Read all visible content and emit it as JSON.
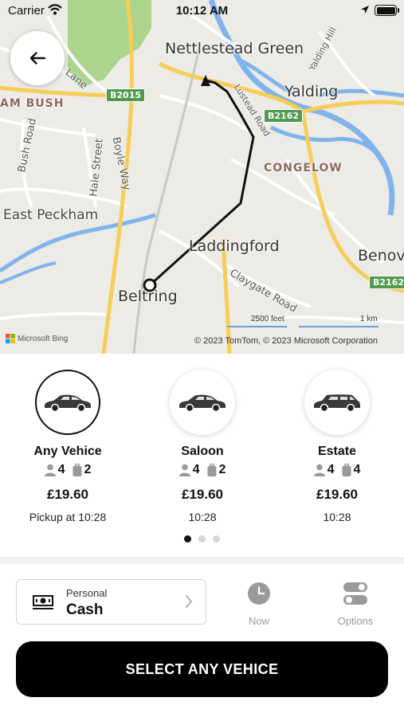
{
  "status_bar": {
    "carrier": "Carrier",
    "time": "10:12 AM"
  },
  "map": {
    "places": {
      "nettlestead_green": "Nettlestead Green",
      "yalding": "Yalding",
      "am_bush": "AM BUSH",
      "congelow": "CONGELOW",
      "east_peckham": "East Peckham",
      "laddingford": "Laddingford",
      "beltring": "Beltring",
      "benov": "Benov"
    },
    "roads": {
      "lane": "Lane",
      "bush_road": "Bush Road",
      "hale_street": "Hale Street",
      "boyle_way": "Boyle Way",
      "yalding_hill": "Yalding Hill",
      "claygate_road": "Claygate Road",
      "lustead_road": "Lustead Road"
    },
    "shields": {
      "b2015": "B2015",
      "b2162_a": "B2162",
      "b2162_b": "B2162"
    },
    "scale_feet": "2500 feet",
    "scale_km": "1 km",
    "attribution_brand": "Microsoft Bing",
    "copyright": "© 2023 TomTom, © 2023 Microsoft Corporation"
  },
  "vehicles": [
    {
      "name": "Any Vehice",
      "passengers": "4",
      "luggage": "2",
      "price": "£19.60",
      "time": "Pickup at 10:28",
      "selected": true
    },
    {
      "name": "Saloon",
      "passengers": "4",
      "luggage": "2",
      "price": "£19.60",
      "time": "10:28",
      "selected": false
    },
    {
      "name": "Estate",
      "passengers": "4",
      "luggage": "4",
      "price": "£19.60",
      "time": "10:28",
      "selected": false
    }
  ],
  "pagination": {
    "count": 3,
    "active": 1
  },
  "payment": {
    "label": "Personal",
    "value": "Cash"
  },
  "quick_actions": {
    "now_label": "Now",
    "options_label": "Options"
  },
  "select_button": "SELECT ANY VEHICE",
  "colors": {
    "primary": "#000000",
    "route": "#111111",
    "water": "#7fb2e8",
    "major_road": "#f4cf5c",
    "park": "#a9d28a",
    "shield": "#4f9a4c",
    "muted_icon": "#9a9a9a"
  }
}
